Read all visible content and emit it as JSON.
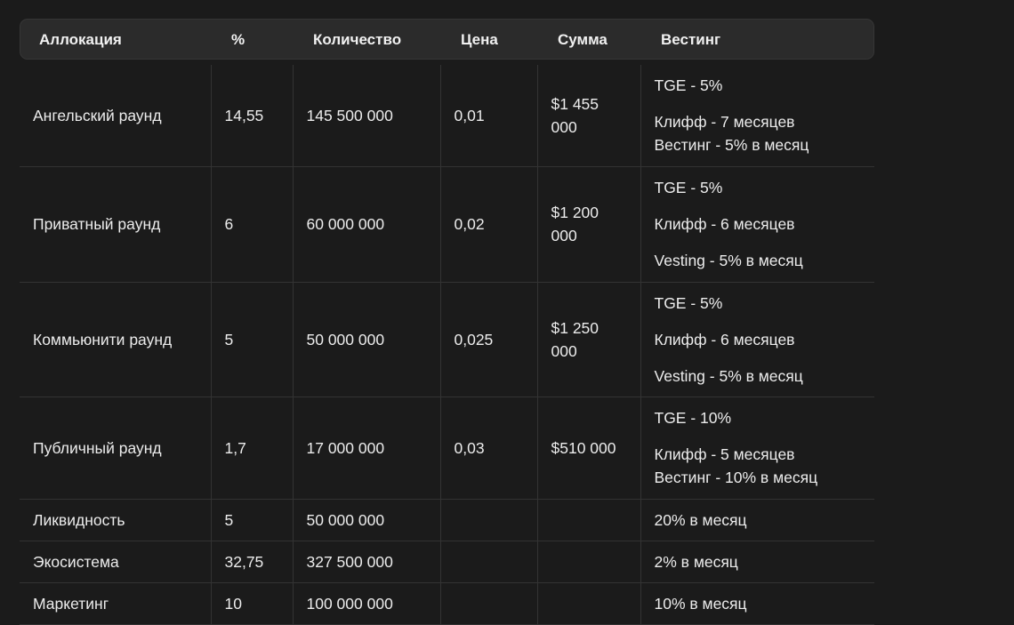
{
  "headers": {
    "allocation": "Аллокация",
    "percent": "%",
    "quantity": "Количество",
    "price": "Цена",
    "sum": "Сумма",
    "vesting": "Вестинг"
  },
  "rows": [
    {
      "allocation": "Ангельский раунд",
      "percent": "14,55",
      "quantity": "145 500 000",
      "price": "0,01",
      "sum": "$1 455 000",
      "vesting": [
        "TGE - 5%",
        "Клифф - 7 месяцев",
        "Вестинг - 5% в месяц"
      ]
    },
    {
      "allocation": "Приватный раунд",
      "percent": "6",
      "quantity": "60 000 000",
      "price": "0,02",
      "sum": "$1 200 000",
      "vesting": [
        "TGE - 5%",
        "Клифф - 6 месяцев",
        "Vesting - 5% в месяц"
      ]
    },
    {
      "allocation": "Коммьюнити раунд",
      "percent": "5",
      "quantity": "50 000 000",
      "price": "0,025",
      "sum": "$1 250 000",
      "vesting": [
        "TGE - 5%",
        "Клифф - 6 месяцев",
        "Vesting - 5% в месяц"
      ]
    },
    {
      "allocation": "Публичный раунд",
      "percent": "1,7",
      "quantity": "17 000 000",
      "price": "0,03",
      "sum": "$510 000",
      "vesting": [
        "TGE - 10%",
        "Клифф - 5 месяцев",
        "Вестинг - 10% в месяц"
      ]
    },
    {
      "allocation": "Ликвидность",
      "percent": "5",
      "quantity": "50 000 000",
      "price": "",
      "sum": "",
      "vesting": [
        "20% в месяц"
      ]
    },
    {
      "allocation": "Экосистема",
      "percent": "32,75",
      "quantity": "327 500 000",
      "price": "",
      "sum": "",
      "vesting": [
        "2% в месяц"
      ]
    },
    {
      "allocation": "Маркетинг",
      "percent": "10",
      "quantity": "100 000 000",
      "price": "",
      "sum": "",
      "vesting": [
        "10% в месяц"
      ]
    }
  ]
}
